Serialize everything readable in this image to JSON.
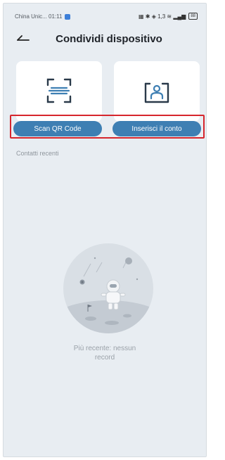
{
  "status_bar": {
    "carrier_time": "China Unic... 01:11",
    "right_icons": "▦ ✱ ◈ 1,3 ≋ ▂▄▆",
    "battery": "88"
  },
  "header": {
    "back_icon": "back-arrow-icon",
    "title": "Condividi dispositivo"
  },
  "share_options": [
    {
      "icon": "scan-qr-icon",
      "label": "Scan QR Code"
    },
    {
      "icon": "account-icon",
      "label": "Inserisci il conto"
    }
  ],
  "recent": {
    "label": "Contatti recenti",
    "empty_message": "Più recente: nessun record"
  },
  "colors": {
    "button_bg": "#3e7fb3",
    "highlight_border": "#d6262d",
    "page_bg": "#e8edf2"
  }
}
